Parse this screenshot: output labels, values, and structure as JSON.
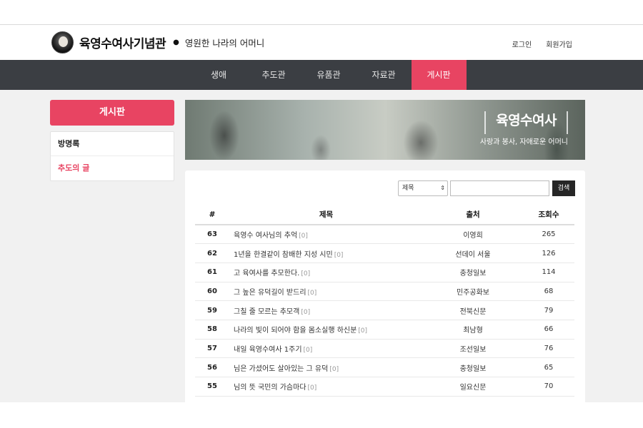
{
  "header": {
    "brand": "육영수여사기념관",
    "tagline": "영원한 나라의 어머니",
    "login": "로그인",
    "signup": "회원가입"
  },
  "nav": {
    "items": [
      {
        "label": "생애"
      },
      {
        "label": "추도관"
      },
      {
        "label": "유품관"
      },
      {
        "label": "자료관"
      },
      {
        "label": "게시판",
        "active": true
      }
    ]
  },
  "sidebar": {
    "title": "게시판",
    "items": [
      {
        "label": "방명록"
      },
      {
        "label": "추도의 글",
        "active": true
      }
    ]
  },
  "banner": {
    "title": "육영수여사",
    "subtitle": "사랑과 봉사, 자애로운 어머니"
  },
  "search": {
    "select_value": "제목",
    "input_value": "",
    "button_label": "검색"
  },
  "table": {
    "headers": {
      "num": "#",
      "title": "제목",
      "source": "출처",
      "views": "조회수"
    },
    "rows": [
      {
        "num": "63",
        "title": "육영수 여사님의 추억",
        "comments": "[0]",
        "source": "이영희",
        "views": "265"
      },
      {
        "num": "62",
        "title": "1년을 한결같이 참배한 지성 시민",
        "comments": "[0]",
        "source": "선데이 서울",
        "views": "126"
      },
      {
        "num": "61",
        "title": "고 육여사를 추모한다.",
        "comments": "[0]",
        "source": "충청일보",
        "views": "114"
      },
      {
        "num": "60",
        "title": "그 높은 유덕길이 받드리",
        "comments": "[0]",
        "source": "민주공화보",
        "views": "68"
      },
      {
        "num": "59",
        "title": "그칠 줄 모르는 추모객",
        "comments": "[0]",
        "source": "전북신문",
        "views": "79"
      },
      {
        "num": "58",
        "title": "나라의 빛이 되어야 함을 몸소실행 하신분",
        "comments": "[0]",
        "source": "최남형",
        "views": "66"
      },
      {
        "num": "57",
        "title": "내일 육영수여사 1주기",
        "comments": "[0]",
        "source": "조선일보",
        "views": "76"
      },
      {
        "num": "56",
        "title": "님은 가셨어도 살아있는 그 유덕",
        "comments": "[0]",
        "source": "충청일보",
        "views": "65"
      },
      {
        "num": "55",
        "title": "님의 뜻 국민의 가슴마다",
        "comments": "[0]",
        "source": "일요신문",
        "views": "70"
      }
    ]
  }
}
